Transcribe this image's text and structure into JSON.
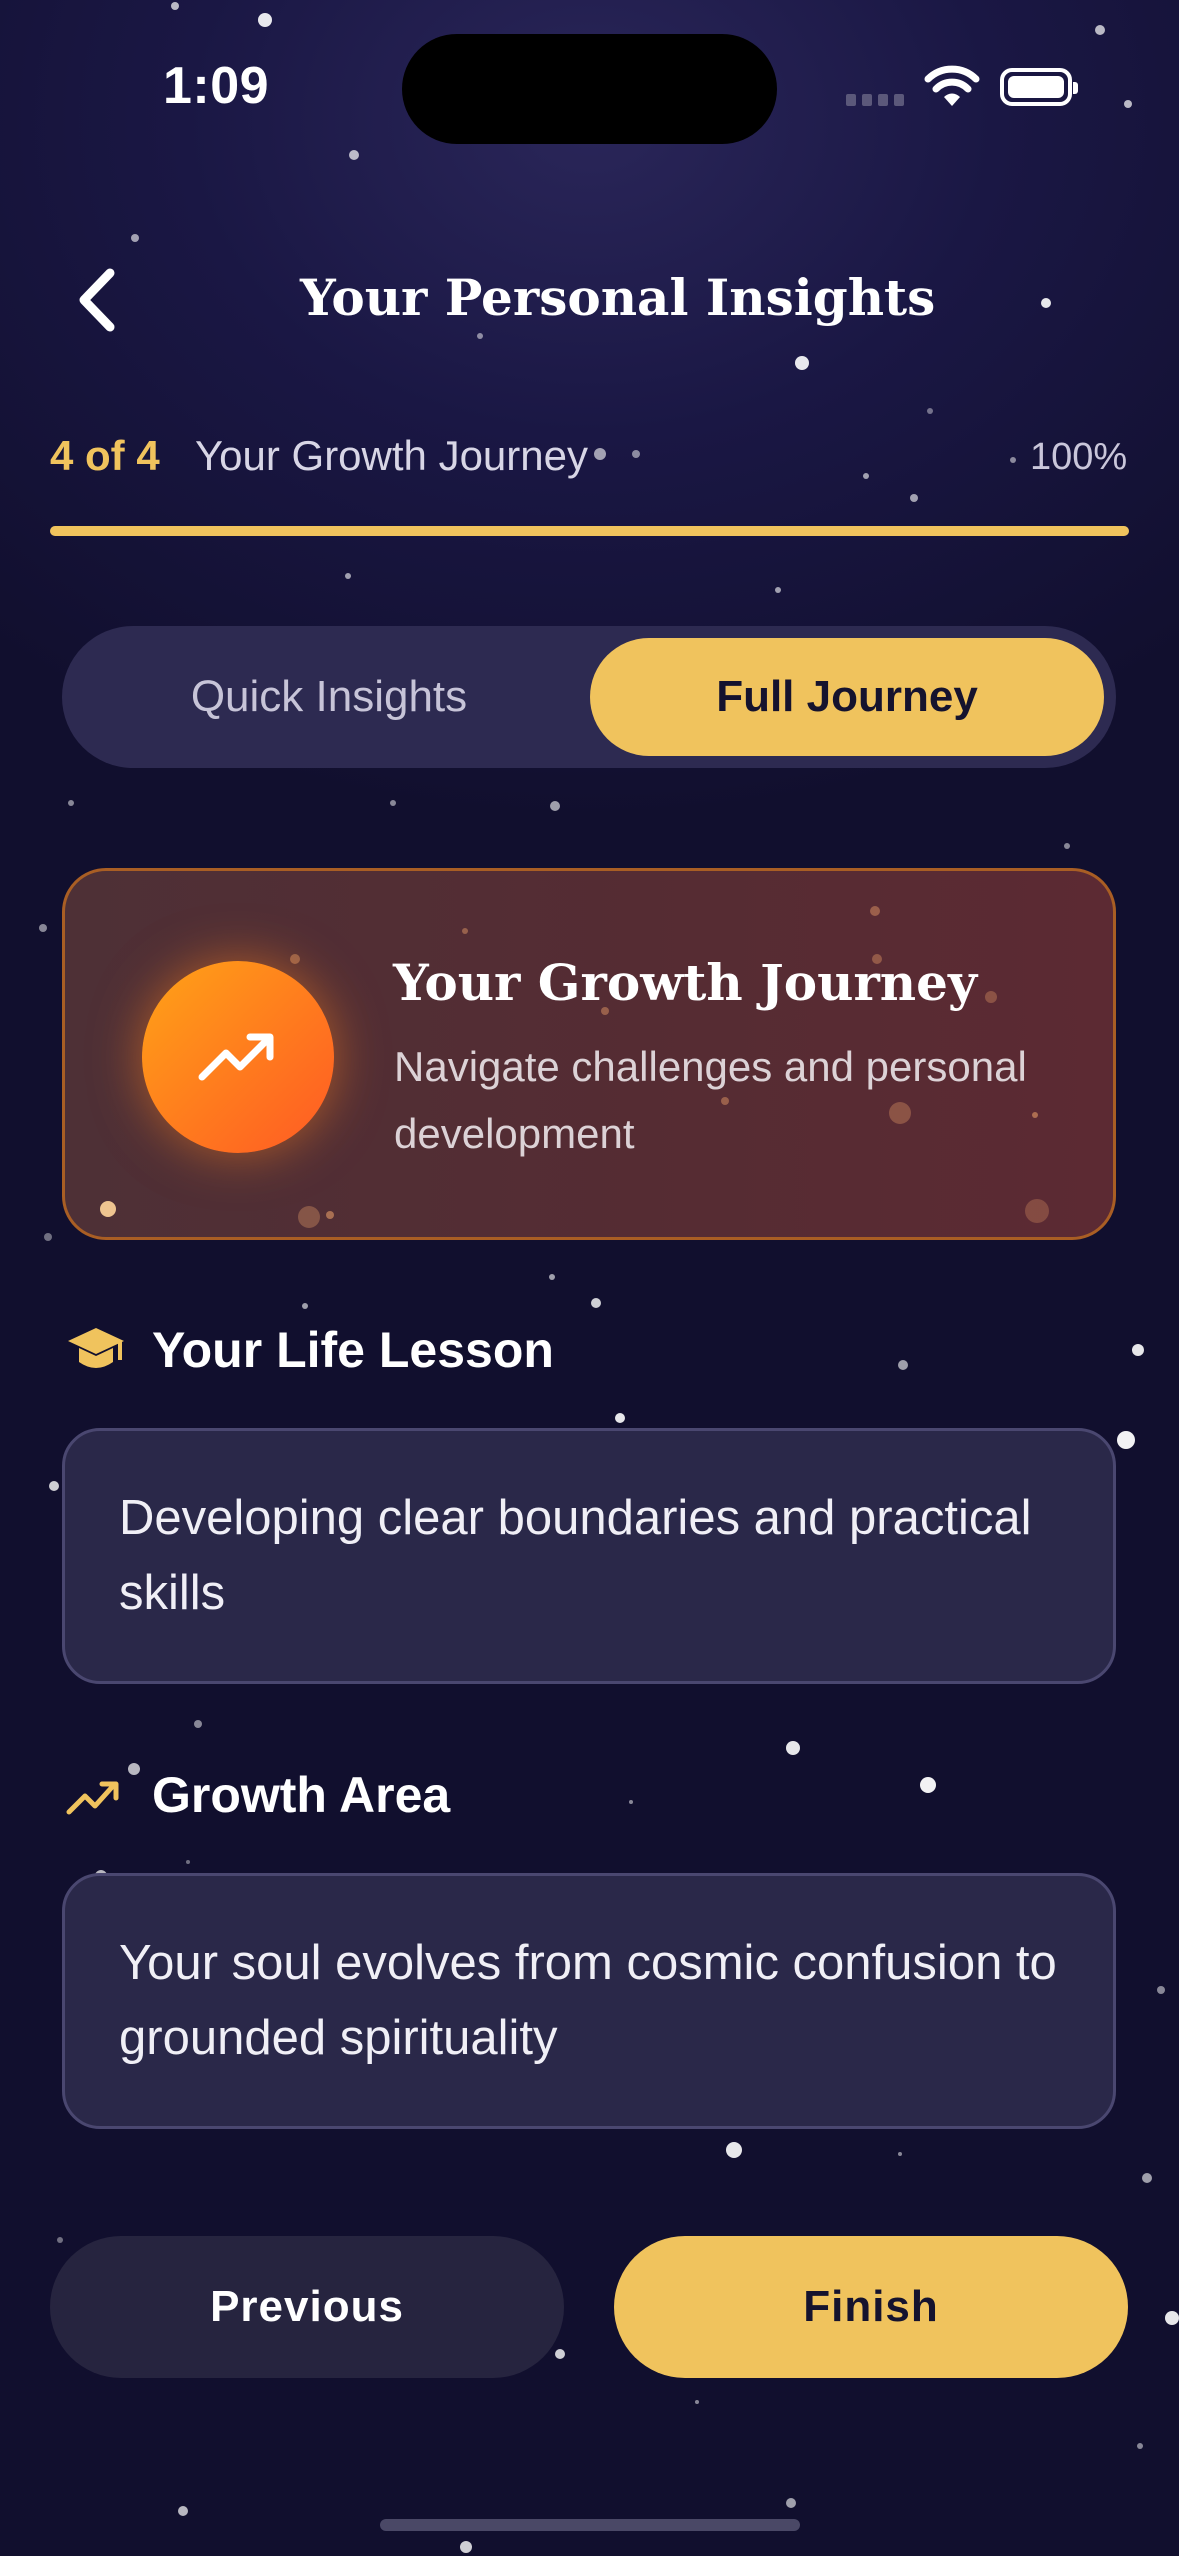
{
  "status_bar": {
    "time": "1:09"
  },
  "header": {
    "title": "Your Personal Insights",
    "back_icon": "chevron-left-icon"
  },
  "progress": {
    "step_label": "4 of 4",
    "step_name": "Your Growth Journey",
    "percent_label": "100%",
    "fraction": 1.0
  },
  "tabs": [
    {
      "label": "Quick Insights",
      "selected": false
    },
    {
      "label": "Full Journey",
      "selected": true
    }
  ],
  "hero": {
    "icon": "trending-up-icon",
    "title": "Your Growth Journey",
    "description": "Navigate challenges and personal development"
  },
  "sections": [
    {
      "icon": "graduation-cap-icon",
      "heading": "Your Life Lesson",
      "text": "Developing clear boundaries and practical skills"
    },
    {
      "icon": "trending-up-icon",
      "heading": "Growth Area",
      "text": "Your soul evolves from cosmic confusion to grounded spirituality"
    }
  ],
  "buttons": {
    "previous": "Previous",
    "finish": "Finish"
  },
  "colors": {
    "accent": "#f0c35d",
    "background": "#16143a",
    "card": "#2a2849",
    "hero_orange": "#ff7a1e"
  }
}
